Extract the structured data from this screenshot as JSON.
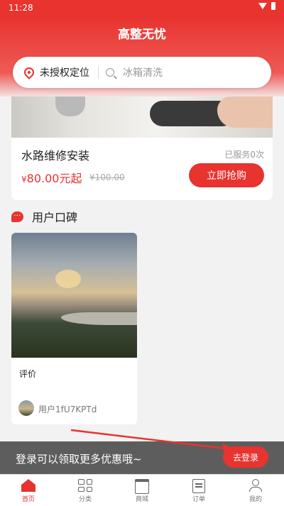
{
  "status_bar": {
    "time": "11:28"
  },
  "header": {
    "title": "高整无忧"
  },
  "search": {
    "location_label": "未授权定位",
    "placeholder": "冰箱清洗"
  },
  "service": {
    "name": "水路维修安装",
    "served_count": "已服务0次",
    "price_currency": "¥",
    "price_value": "80.00元起",
    "original_price": "¥100.00",
    "buy_label": "立即抢购"
  },
  "reviews_section": {
    "title": "用户口碑",
    "items": [
      {
        "text": "评价",
        "user": "用户1fU7KPTd"
      }
    ]
  },
  "login_banner": {
    "text": "登录可以领取更多优惠哦~",
    "button_label": "去登录"
  },
  "tab_bar": {
    "items": [
      {
        "label": "首页",
        "icon": "home-icon",
        "active": true
      },
      {
        "label": "分类",
        "icon": "grid-icon",
        "active": false
      },
      {
        "label": "商城",
        "icon": "store-icon",
        "active": false
      },
      {
        "label": "订单",
        "icon": "order-icon",
        "active": false
      },
      {
        "label": "我的",
        "icon": "user-icon",
        "active": false
      }
    ]
  },
  "colors": {
    "accent": "#e8332f",
    "banner_bg": "#525252"
  }
}
